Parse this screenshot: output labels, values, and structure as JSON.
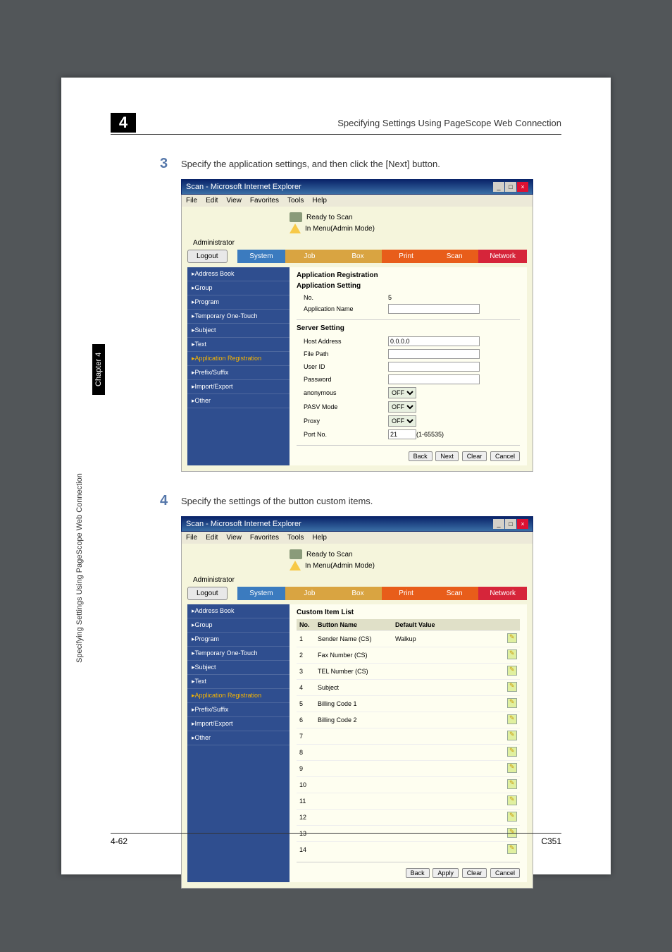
{
  "header": {
    "chapter_num": "4",
    "title": "Specifying Settings Using PageScope Web Connection"
  },
  "steps": {
    "s3": {
      "num": "3",
      "text": "Specify the application settings, and then click the [Next] button."
    },
    "s4": {
      "num": "4",
      "text": "Specify the settings of the button custom items."
    }
  },
  "window": {
    "title": "Scan - Microsoft Internet Explorer",
    "menu": {
      "file": "File",
      "edit": "Edit",
      "view": "View",
      "favorites": "Favorites",
      "tools": "Tools",
      "help": "Help"
    },
    "status1": "Ready to Scan",
    "status2": "In Menu(Admin Mode)",
    "admin": "Administrator",
    "logout": "Logout",
    "tabs": {
      "system": "System",
      "job": "Job",
      "box": "Box",
      "print": "Print",
      "scan": "Scan",
      "network": "Network"
    }
  },
  "sidebar": {
    "address": "▸Address Book",
    "group": "▸Group",
    "program": "▸Program",
    "temp": "▸Temporary One-Touch",
    "subject": "▸Subject",
    "text": "▸Text",
    "appreg": "▸Application Registration",
    "prefix": "▸Prefix/Suffix",
    "impexp": "▸Import/Export",
    "other": "▸Other"
  },
  "panel1": {
    "heading1": "Application Registration",
    "heading2": "Application Setting",
    "no_label": "No.",
    "no_value": "5",
    "appname_label": "Application Name",
    "appname_value": "",
    "heading3": "Server Setting",
    "host_label": "Host Address",
    "host_value": "0.0.0.0",
    "filepath_label": "File Path",
    "filepath_value": "",
    "userid_label": "User ID",
    "userid_value": "",
    "password_label": "Password",
    "password_value": "",
    "anon_label": "anonymous",
    "anon_value": "OFF",
    "pasv_label": "PASV Mode",
    "pasv_value": "OFF",
    "proxy_label": "Proxy",
    "proxy_value": "OFF",
    "port_label": "Port No.",
    "port_value": "21",
    "port_range": "(1-65535)",
    "btn_back": "Back",
    "btn_next": "Next",
    "btn_clear": "Clear",
    "btn_cancel": "Cancel"
  },
  "panel2": {
    "heading": "Custom Item List",
    "col_no": "No.",
    "col_name": "Button Name",
    "col_default": "Default Value",
    "rows": [
      {
        "no": "1",
        "name": "Sender Name (CS)",
        "val": "Walkup"
      },
      {
        "no": "2",
        "name": "Fax Number (CS)",
        "val": ""
      },
      {
        "no": "3",
        "name": "TEL Number (CS)",
        "val": ""
      },
      {
        "no": "4",
        "name": "Subject",
        "val": ""
      },
      {
        "no": "5",
        "name": "Billing Code 1",
        "val": ""
      },
      {
        "no": "6",
        "name": "Billing Code 2",
        "val": ""
      },
      {
        "no": "7",
        "name": "",
        "val": ""
      },
      {
        "no": "8",
        "name": "",
        "val": ""
      },
      {
        "no": "9",
        "name": "",
        "val": ""
      },
      {
        "no": "10",
        "name": "",
        "val": ""
      },
      {
        "no": "11",
        "name": "",
        "val": ""
      },
      {
        "no": "12",
        "name": "",
        "val": ""
      },
      {
        "no": "13",
        "name": "",
        "val": ""
      },
      {
        "no": "14",
        "name": "",
        "val": ""
      }
    ],
    "btn_back": "Back",
    "btn_apply": "Apply",
    "btn_clear": "Clear",
    "btn_cancel": "Cancel"
  },
  "side": {
    "long": "Specifying Settings Using PageScope Web Connection",
    "chapter": "Chapter 4"
  },
  "footer": {
    "left": "4-62",
    "right": "C351"
  }
}
